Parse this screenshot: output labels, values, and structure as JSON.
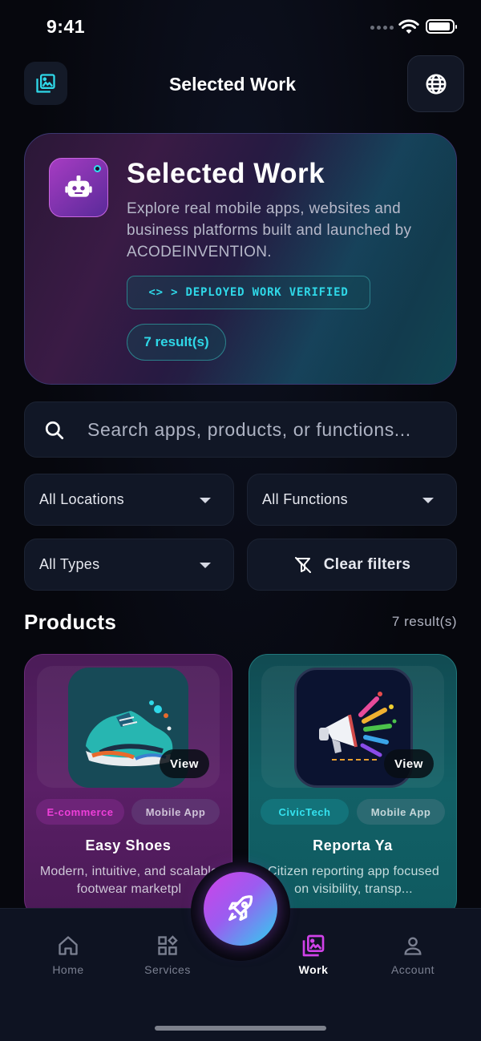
{
  "status": {
    "time": "9:41"
  },
  "header": {
    "title": "Selected Work",
    "left_icon": "gallery-icon",
    "right_icon": "globe-icon"
  },
  "hero": {
    "title": "Selected Work",
    "description": "Explore real mobile apps, websites and business platforms built and launched by ACODEINVENTION.",
    "badge": "<> > DEPLOYED WORK VERIFIED",
    "count": "7 result(s)",
    "avatar_icon": "robot-icon"
  },
  "search": {
    "placeholder": "Search apps, products, or functions...",
    "value": ""
  },
  "filters": {
    "locations": "All Locations",
    "functions": "All Functions",
    "types": "All Types",
    "clear": "Clear filters"
  },
  "products": {
    "title": "Products",
    "count": "7 result(s)",
    "items": [
      {
        "name": "Easy Shoes",
        "tags": [
          "E-commerce",
          "Mobile App"
        ],
        "description": "Modern, intuitive, and scalable footwear marketpl",
        "view_label": "View",
        "image": "sneaker-icon"
      },
      {
        "name": "Reporta Ya",
        "tags": [
          "CivicTech",
          "Mobile App"
        ],
        "description": "Citizen reporting app focused on visibility, transp...",
        "view_label": "View",
        "image": "megaphone-icon"
      }
    ]
  },
  "nav": {
    "items": [
      {
        "label": "Home",
        "icon": "home-icon"
      },
      {
        "label": "Services",
        "icon": "grid-icon"
      },
      {
        "label": "Work",
        "icon": "gallery-icon",
        "active": true
      },
      {
        "label": "Account",
        "icon": "user-icon"
      }
    ],
    "fab_icon": "rocket-icon"
  },
  "colors": {
    "background": "#06070d",
    "accent_cyan": "#2fd8e8",
    "accent_magenta": "#d042e8",
    "card_purple": "#5a1f66",
    "card_teal": "#126066"
  }
}
